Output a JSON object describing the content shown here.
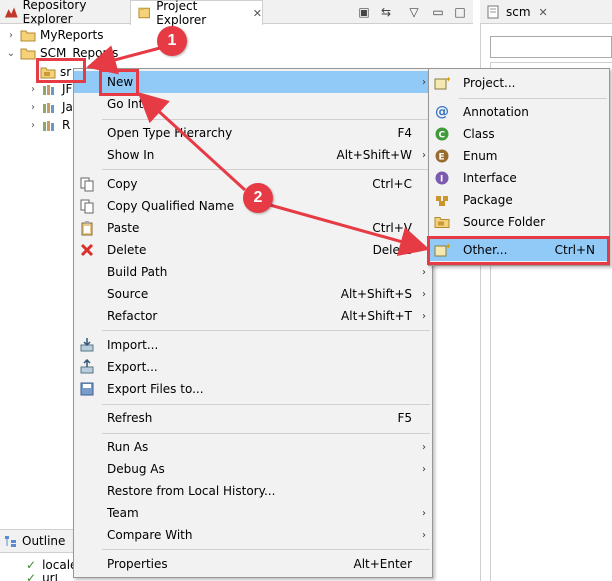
{
  "tabs": {
    "repository_explorer": "Repository Explorer",
    "project_explorer": "Project Explorer",
    "scm": "scm",
    "outline": "Outline"
  },
  "tree": {
    "items": [
      {
        "label": "MyReports",
        "expanded": false
      },
      {
        "label": "SCM_Reports",
        "expanded": true
      },
      {
        "label": "sr"
      },
      {
        "label": "JF"
      },
      {
        "label": "Ja"
      },
      {
        "label": "R"
      }
    ],
    "outline_items": [
      "locale",
      "url"
    ]
  },
  "context_menu": {
    "items": [
      {
        "label": "New",
        "shortcut": "",
        "submenu": true
      },
      {
        "label": "Go Into",
        "shortcut": "",
        "submenu": false
      },
      {
        "label": "Open Type Hierarchy",
        "shortcut": "F4",
        "submenu": false
      },
      {
        "label": "Show In",
        "shortcut": "Alt+Shift+W",
        "submenu": true
      },
      {
        "label": "Copy",
        "shortcut": "Ctrl+C",
        "submenu": false
      },
      {
        "label": "Copy Qualified Name",
        "shortcut": "",
        "submenu": false
      },
      {
        "label": "Paste",
        "shortcut": "Ctrl+V",
        "submenu": false
      },
      {
        "label": "Delete",
        "shortcut": "Delete",
        "submenu": false
      },
      {
        "label": "Build Path",
        "shortcut": "",
        "submenu": true
      },
      {
        "label": "Source",
        "shortcut": "Alt+Shift+S",
        "submenu": true
      },
      {
        "label": "Refactor",
        "shortcut": "Alt+Shift+T",
        "submenu": true
      },
      {
        "label": "Import...",
        "shortcut": "",
        "submenu": false
      },
      {
        "label": "Export...",
        "shortcut": "",
        "submenu": false
      },
      {
        "label": "Export Files to...",
        "shortcut": "",
        "submenu": false
      },
      {
        "label": "Refresh",
        "shortcut": "F5",
        "submenu": false
      },
      {
        "label": "Run As",
        "shortcut": "",
        "submenu": true
      },
      {
        "label": "Debug As",
        "shortcut": "",
        "submenu": true
      },
      {
        "label": "Restore from Local History...",
        "shortcut": "",
        "submenu": false
      },
      {
        "label": "Team",
        "shortcut": "",
        "submenu": true
      },
      {
        "label": "Compare With",
        "shortcut": "",
        "submenu": true
      },
      {
        "label": "Properties",
        "shortcut": "Alt+Enter",
        "submenu": false
      }
    ]
  },
  "new_submenu": {
    "items": [
      {
        "label": "Project...",
        "shortcut": ""
      },
      {
        "label": "Annotation",
        "shortcut": ""
      },
      {
        "label": "Class",
        "shortcut": ""
      },
      {
        "label": "Enum",
        "shortcut": ""
      },
      {
        "label": "Interface",
        "shortcut": ""
      },
      {
        "label": "Package",
        "shortcut": ""
      },
      {
        "label": "Source Folder",
        "shortcut": ""
      },
      {
        "label": "Other...",
        "shortcut": "Ctrl+N"
      }
    ]
  },
  "annotations": {
    "step1": "1",
    "step2": "2",
    "color": "#e63a45"
  },
  "colors": {
    "highlight": "#91c9f7",
    "menu_bg": "#f2f2f2",
    "annotation_red": "#e63a45"
  }
}
